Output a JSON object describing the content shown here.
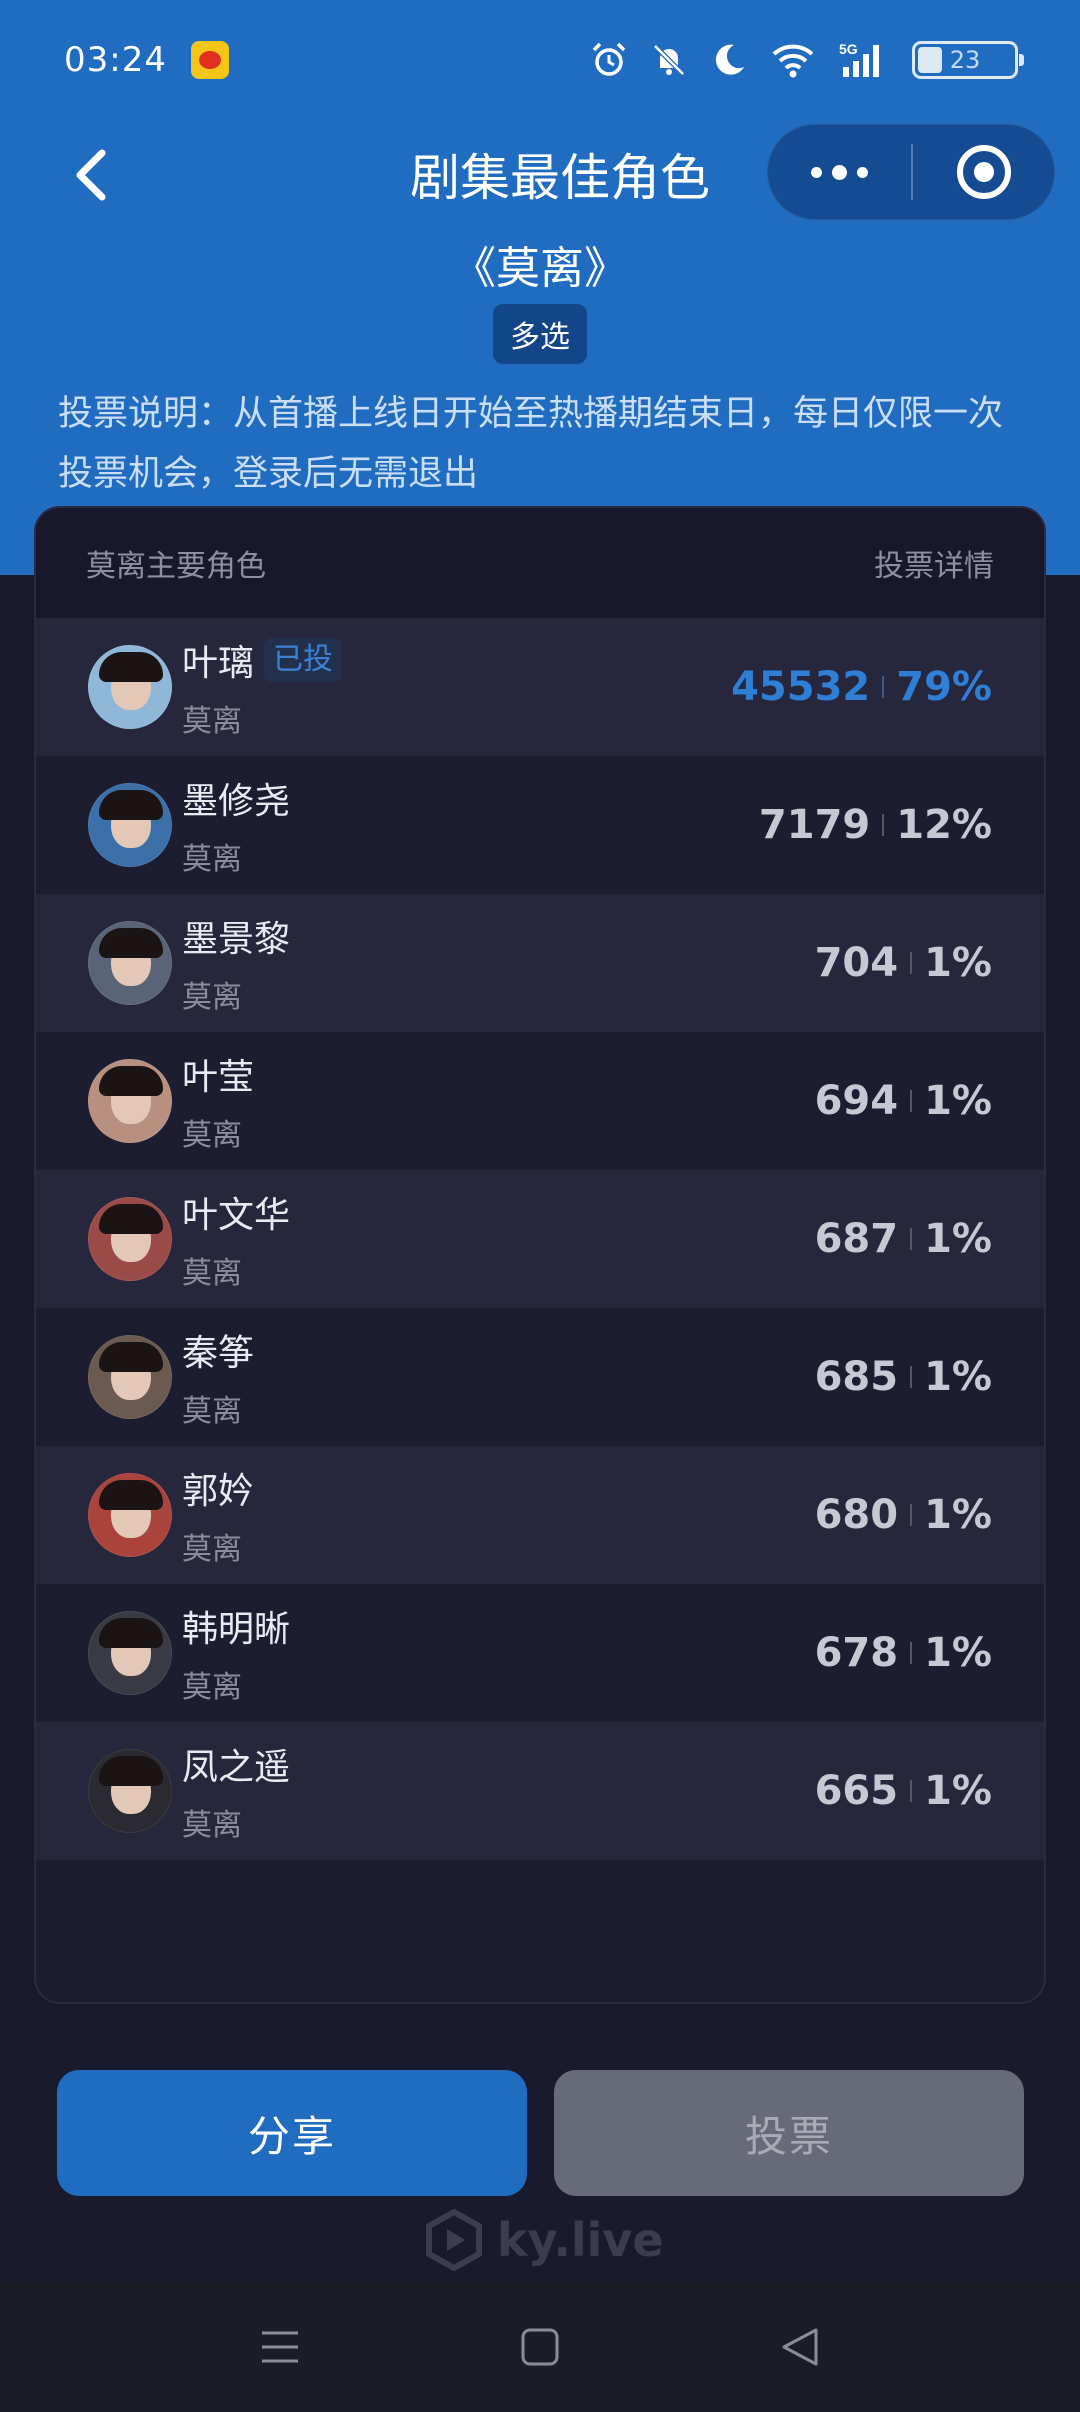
{
  "status_bar": {
    "time": "03:24",
    "battery": "23",
    "icons": [
      "weibo-icon",
      "alarm-icon",
      "mute-icon",
      "moon-icon",
      "wifi-icon",
      "5g-signal-icon",
      "battery-icon"
    ]
  },
  "nav": {
    "back_icon": "chevron-left-icon",
    "title": "剧集最佳角色",
    "more_icon": "more-dots-icon",
    "close_icon": "target-close-icon"
  },
  "show": {
    "title": "《莫离》",
    "mode_badge": "多选",
    "description": "投票说明：从首播上线日开始至热播期结束日，每日仅限一次投票机会，登录后无需退出"
  },
  "list": {
    "header_left": "莫离主要角色",
    "header_right": "投票详情",
    "voted_label": "已投",
    "items": [
      {
        "name": "叶璃",
        "show": "莫离",
        "votes": "45532",
        "percent": "79%",
        "voted": true
      },
      {
        "name": "墨修尧",
        "show": "莫离",
        "votes": "7179",
        "percent": "12%",
        "voted": false
      },
      {
        "name": "墨景黎",
        "show": "莫离",
        "votes": "704",
        "percent": "1%",
        "voted": false
      },
      {
        "name": "叶莹",
        "show": "莫离",
        "votes": "694",
        "percent": "1%",
        "voted": false
      },
      {
        "name": "叶文华",
        "show": "莫离",
        "votes": "687",
        "percent": "1%",
        "voted": false
      },
      {
        "name": "秦筝",
        "show": "莫离",
        "votes": "685",
        "percent": "1%",
        "voted": false
      },
      {
        "name": "郭妗",
        "show": "莫离",
        "votes": "680",
        "percent": "1%",
        "voted": false
      },
      {
        "name": "韩明晰",
        "show": "莫离",
        "votes": "678",
        "percent": "1%",
        "voted": false
      },
      {
        "name": "凤之遥",
        "show": "莫离",
        "votes": "665",
        "percent": "1%",
        "voted": false
      }
    ]
  },
  "buttons": {
    "share": "分享",
    "vote": "投票"
  },
  "brand": "ky.live",
  "colors": {
    "accent": "#1f6cc0",
    "background": "#1a1a2e",
    "voted_text": "#2f7fd6",
    "disabled_button": "#676a78"
  }
}
